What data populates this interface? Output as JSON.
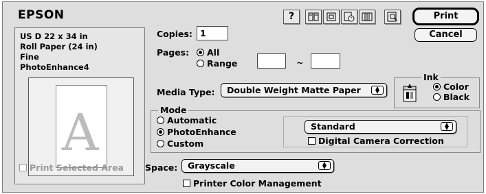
{
  "header": {
    "brand": "EPSON"
  },
  "toolbar": {
    "icons": [
      "help-icon",
      "layout-icon",
      "page-setup-icon",
      "printer-utility-icon",
      "watermark-icon",
      "preview-icon"
    ],
    "help_label": "?"
  },
  "buttons": {
    "print": "Print",
    "cancel": "Cancel"
  },
  "summary": {
    "lines": [
      "US D 22 x 34 in",
      "Roll Paper (24 in)",
      "Fine",
      "PhotoEnhance4"
    ],
    "preview_letter": "A"
  },
  "copies": {
    "label": "Copies:",
    "value": "1"
  },
  "pages": {
    "label": "Pages:",
    "all": "All",
    "range": "Range",
    "range_sep": "~",
    "from": "",
    "to": "",
    "selected": "All"
  },
  "media": {
    "label": "Media Type:",
    "value": "Double Weight Matte Paper"
  },
  "ink": {
    "title": "Ink",
    "color": "Color",
    "black": "Black",
    "selected": "Color"
  },
  "mode": {
    "title": "Mode",
    "automatic": "Automatic",
    "photoenhance": "PhotoEnhance",
    "custom": "Custom",
    "selected": "PhotoEnhance",
    "setting": "Standard",
    "digital_camera": "Digital Camera Correction"
  },
  "print_selected_area": "Print Selected Area",
  "space": {
    "label": "Space:",
    "value": "Grayscale"
  },
  "printer_color_management": "Printer Color Management"
}
